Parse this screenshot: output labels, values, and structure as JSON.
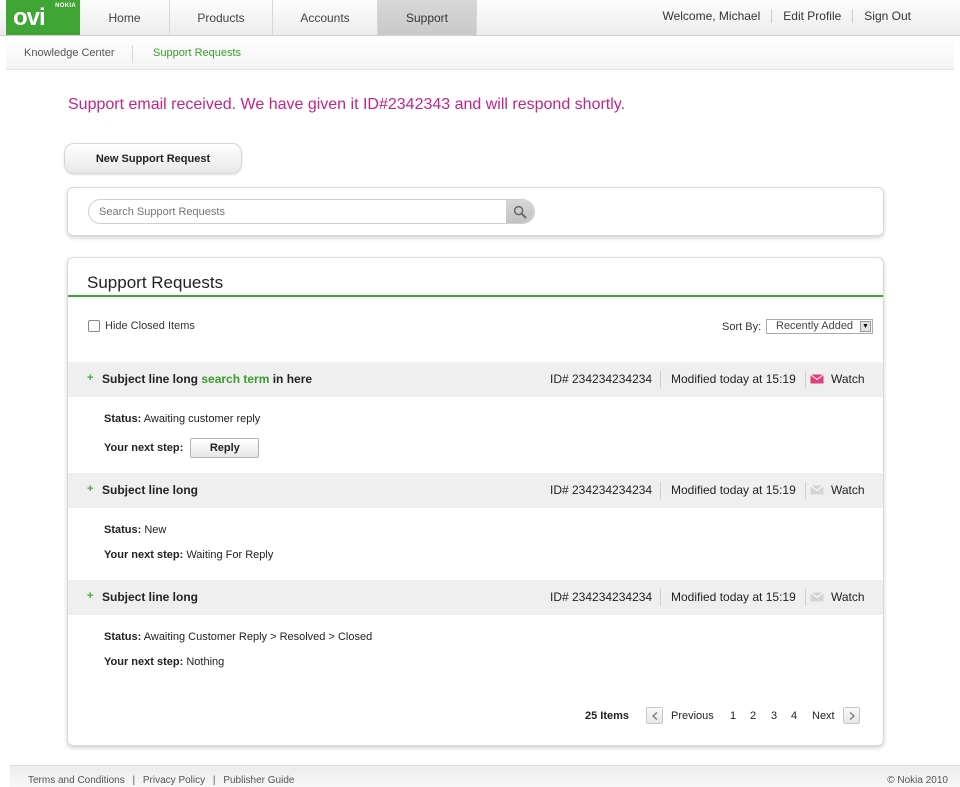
{
  "brand": {
    "name": "ovi",
    "sub": "NOKIA"
  },
  "nav": {
    "tabs": [
      {
        "label": "Home"
      },
      {
        "label": "Products"
      },
      {
        "label": "Accounts"
      },
      {
        "label": "Support"
      }
    ],
    "user_links": [
      "Welcome, Michael",
      "Edit Profile",
      "Sign Out"
    ]
  },
  "subnav": {
    "items": [
      "Knowledge Center",
      "Support Requests"
    ]
  },
  "confirmation": "Support email received. We have given it ID#2342343 and will respond shortly.",
  "new_request_label": "New Support Request",
  "search": {
    "placeholder": "Search Support Requests"
  },
  "requests": {
    "title": "Support Requests",
    "hide_closed_label": "Hide Closed Items",
    "sort_label": "Sort By:",
    "sort_value": "Recently Added",
    "items": [
      {
        "subject_before": "Subject line long ",
        "subject_highlight": "search term",
        "subject_after": " in here",
        "id": "ID# 234234234234",
        "modified": "Modified today at 15:19",
        "watch": "Watch",
        "watching": true,
        "status_label": "Status:",
        "status": "Awaiting customer reply",
        "next_label": "Your next step:",
        "next": "",
        "next_button": "Reply"
      },
      {
        "subject_before": "Subject line long",
        "subject_highlight": "",
        "subject_after": "",
        "id": "ID# 234234234234",
        "modified": "Modified today at 15:19",
        "watch": "Watch",
        "watching": false,
        "status_label": "Status:",
        "status": "New",
        "next_label": "Your next step:",
        "next": "Waiting For Reply",
        "next_button": ""
      },
      {
        "subject_before": "Subject line long",
        "subject_highlight": "",
        "subject_after": "",
        "id": "ID# 234234234234",
        "modified": "Modified today at 15:19",
        "watch": "Watch",
        "watching": false,
        "status_label": "Status:",
        "status": "Awaiting Customer Reply > Resolved > Closed",
        "next_label": "Your next step:",
        "next": "Nothing",
        "next_button": ""
      }
    ],
    "pagination": {
      "count": "25 Items",
      "previous": "Previous",
      "pages": [
        "1",
        "2",
        "3",
        "4"
      ],
      "next": "Next"
    }
  },
  "footer": {
    "links": [
      "Terms and Conditions",
      "Privacy Policy",
      "Publisher Guide"
    ],
    "separator": "|",
    "copyright": "© Nokia 2010"
  },
  "colors": {
    "brand_green": "#3fa535",
    "link_green": "#3a9c2c",
    "confirmation_magenta": "#c4238a",
    "watch_active": "#e0407a"
  }
}
